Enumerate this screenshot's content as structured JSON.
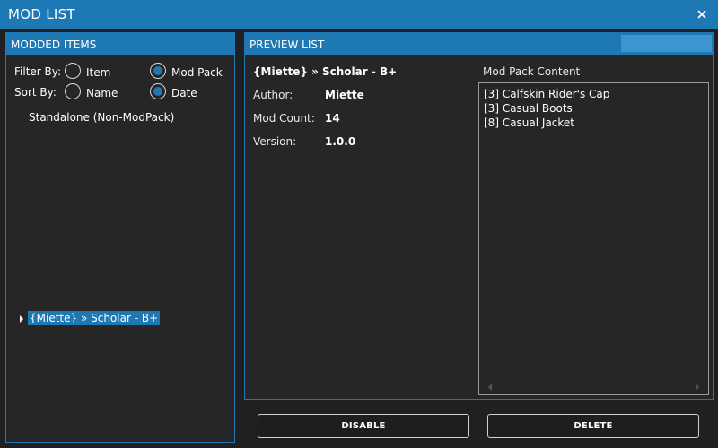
{
  "window": {
    "title": "MOD LIST"
  },
  "modded_items": {
    "header": "MODDED ITEMS",
    "filter_label": "Filter By:",
    "filter_options": [
      {
        "label": "Item",
        "selected": false
      },
      {
        "label": "Mod Pack",
        "selected": true
      }
    ],
    "sort_label": "Sort By:",
    "sort_options": [
      {
        "label": "Name",
        "selected": false
      },
      {
        "label": "Date",
        "selected": true
      }
    ],
    "standalone_label": "Standalone (Non-ModPack)",
    "tree_items": [
      {
        "label": "{Miette} » Scholar - B+",
        "selected": true,
        "expanded": false
      }
    ]
  },
  "preview": {
    "header": "PREVIEW LIST",
    "pack_title": "{Miette} » Scholar - B+",
    "author_label": "Author:",
    "author_value": "Miette",
    "mod_count_label": "Mod Count:",
    "mod_count_value": "14",
    "version_label": "Version:",
    "version_value": "1.0.0",
    "content_label": "Mod Pack Content",
    "content_items": [
      "[3] Calfskin Rider's Cap",
      "[3] Casual Boots",
      "[8] Casual Jacket"
    ]
  },
  "actions": {
    "disable_label": "DISABLE",
    "delete_label": "DELETE"
  },
  "colors": {
    "accent": "#1e78b4",
    "background": "#202020",
    "panel": "#262626"
  }
}
